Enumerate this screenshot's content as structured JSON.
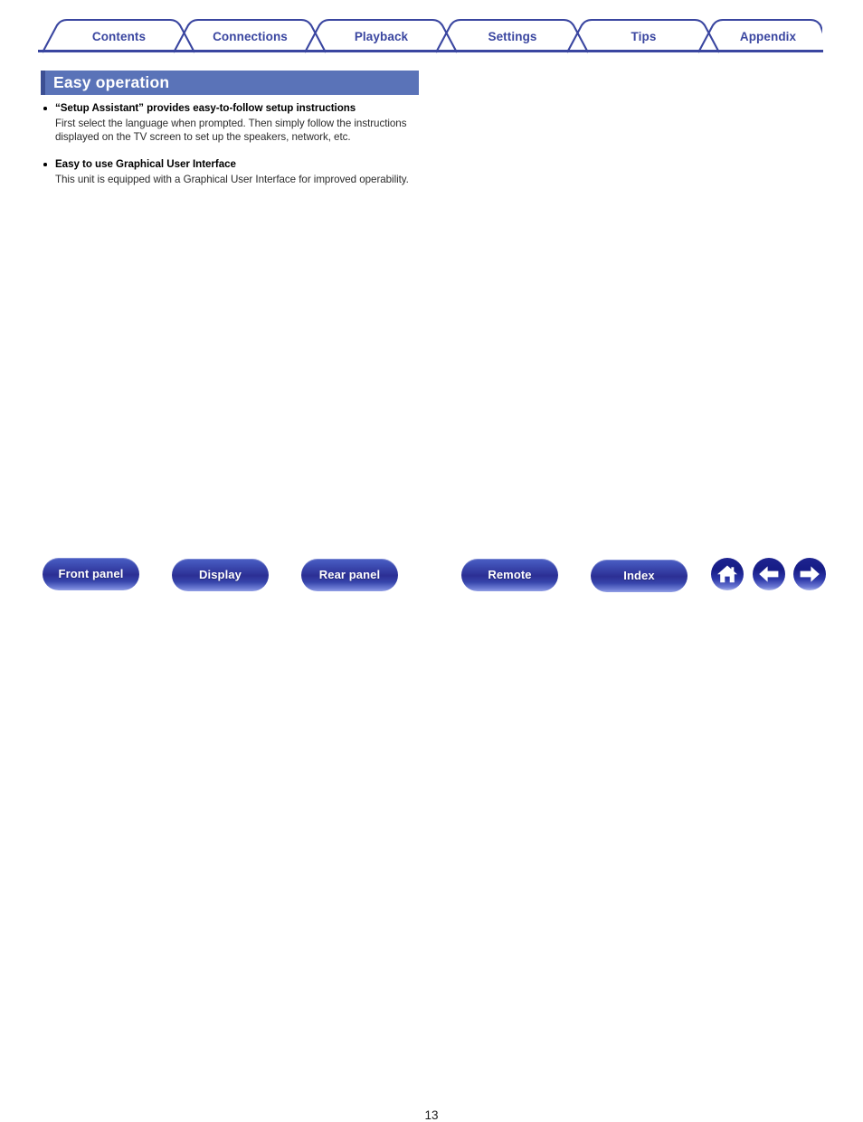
{
  "nav": {
    "tabs": [
      {
        "label": "Contents"
      },
      {
        "label": "Connections"
      },
      {
        "label": "Playback"
      },
      {
        "label": "Settings"
      },
      {
        "label": "Tips"
      },
      {
        "label": "Appendix"
      }
    ]
  },
  "page": {
    "title": "Easy operation",
    "number": "13"
  },
  "sections": [
    {
      "heading": "“Setup Assistant” provides easy-to-follow setup instructions",
      "body": "First select the language when prompted. Then simply follow the instructions displayed on the TV screen to set up the speakers, network, etc."
    },
    {
      "heading": "Easy to use Graphical User Interface",
      "body": "This unit is equipped with a Graphical User Interface for improved operability."
    }
  ],
  "footer": {
    "buttons": [
      {
        "label": "Front panel"
      },
      {
        "label": "Display"
      },
      {
        "label": "Rear panel"
      },
      {
        "label": "Remote"
      },
      {
        "label": "Index"
      }
    ],
    "icons": [
      {
        "name": "home-icon"
      },
      {
        "name": "back-arrow-icon"
      },
      {
        "name": "forward-arrow-icon"
      }
    ]
  },
  "colors": {
    "tab_blue": "#3a46a0",
    "title_bg": "#5a73b8",
    "title_accent": "#3c4f93",
    "button_blue": "#2c2f94"
  }
}
